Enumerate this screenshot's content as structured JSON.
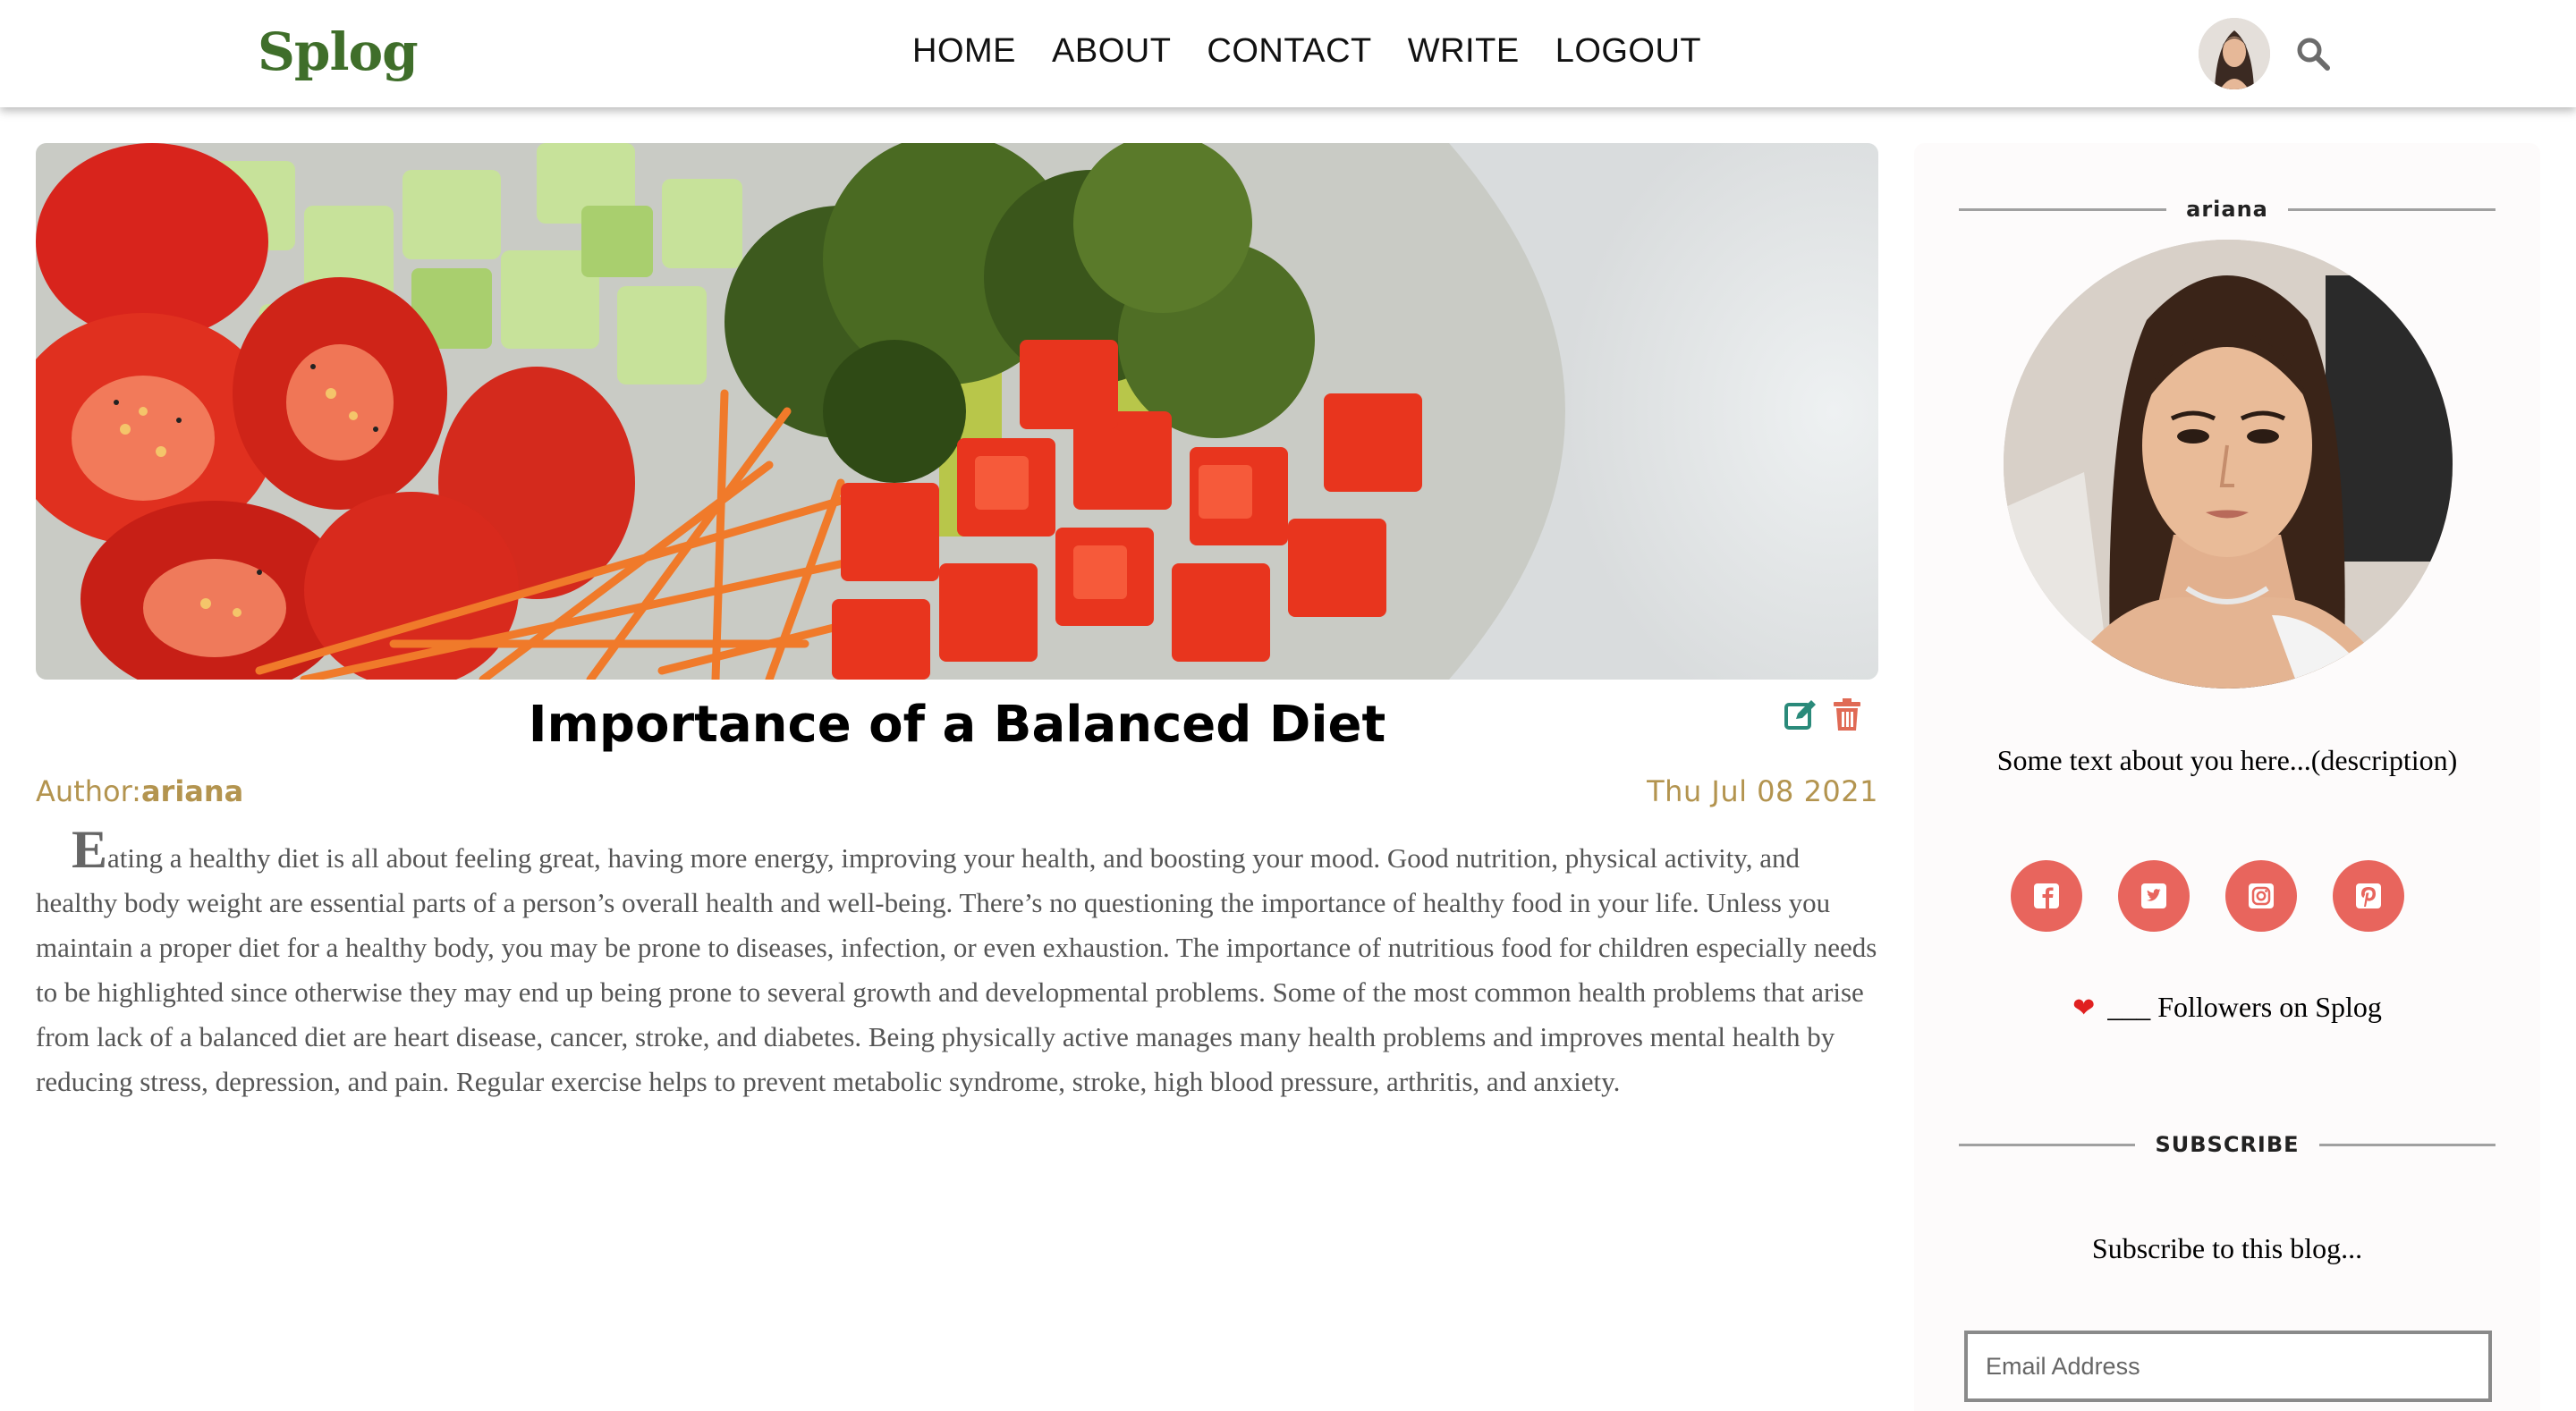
{
  "header": {
    "brand": "Splog",
    "nav": [
      "HOME",
      "ABOUT",
      "CONTACT",
      "WRITE",
      "LOGOUT"
    ]
  },
  "post": {
    "title": "Importance of a Balanced Diet",
    "author_prefix": "Author:",
    "author": "ariana",
    "date": "Thu Jul 08 2021",
    "dropcap": "E",
    "body": "ating a healthy diet is all about feeling great, having more energy, improving your health, and boosting your mood. Good nutrition, physical activity, and healthy body weight are essential parts of a person’s overall health and well-being. There’s no questioning the importance of healthy food in your life. Unless you maintain a proper diet for a healthy body, you may be prone to diseases, infection, or even exhaustion. The importance of nutritious food for children especially needs to be highlighted since otherwise they may end up being prone to several growth and developmental problems. Some of the most common health problems that arise from lack of a balanced diet are heart disease, cancer, stroke, and diabetes. Being physically active manages many health problems and improves mental health by reducing stress, depression, and pain. Regular exercise helps to prevent metabolic syndrome, stroke, high blood pressure, arthritis, and anxiety."
  },
  "sidebar": {
    "username": "ariana",
    "description": "Some text about you here...(description)",
    "social": [
      "facebook-icon",
      "twitter-icon",
      "instagram-icon",
      "pinterest-icon"
    ],
    "followers": "___ Followers on Splog",
    "subscribe_heading": "SUBSCRIBE",
    "subscribe_text": "Subscribe to this blog...",
    "email_placeholder": "Email Address"
  },
  "colors": {
    "brand": "#3f6e2a",
    "meta": "#b3944f",
    "social": "#e8655d",
    "edit": "#2a8a7a",
    "delete": "#e06a55"
  }
}
